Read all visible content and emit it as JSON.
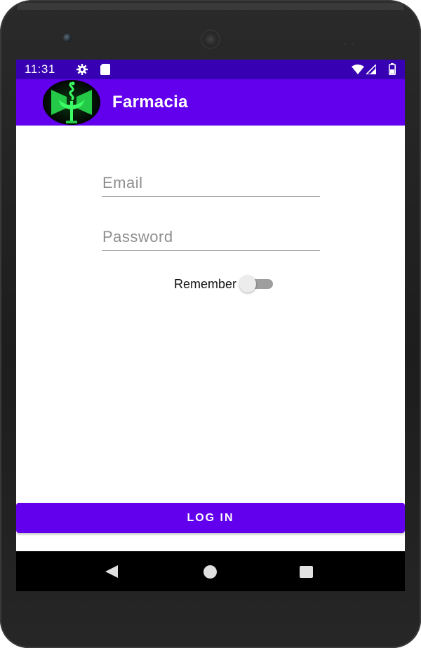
{
  "status_bar": {
    "time": "11:31",
    "icons": [
      "gear-icon",
      "sd-card-icon",
      "wifi-icon",
      "signal-icon",
      "battery-icon"
    ]
  },
  "app_bar": {
    "title": "Farmacia",
    "logo_icon": "pharmacy-logo-icon"
  },
  "form": {
    "email_placeholder": "Email",
    "email_value": "",
    "password_placeholder": "Password",
    "password_value": "",
    "remember_label": "Remember",
    "remember_checked": false,
    "login_label": "LOG IN"
  },
  "nav": {
    "icons": [
      "back-icon",
      "home-icon",
      "recents-icon"
    ]
  },
  "colors": {
    "status_bar": "#3700b3",
    "primary": "#6200ee",
    "nav_bar": "#000000"
  }
}
